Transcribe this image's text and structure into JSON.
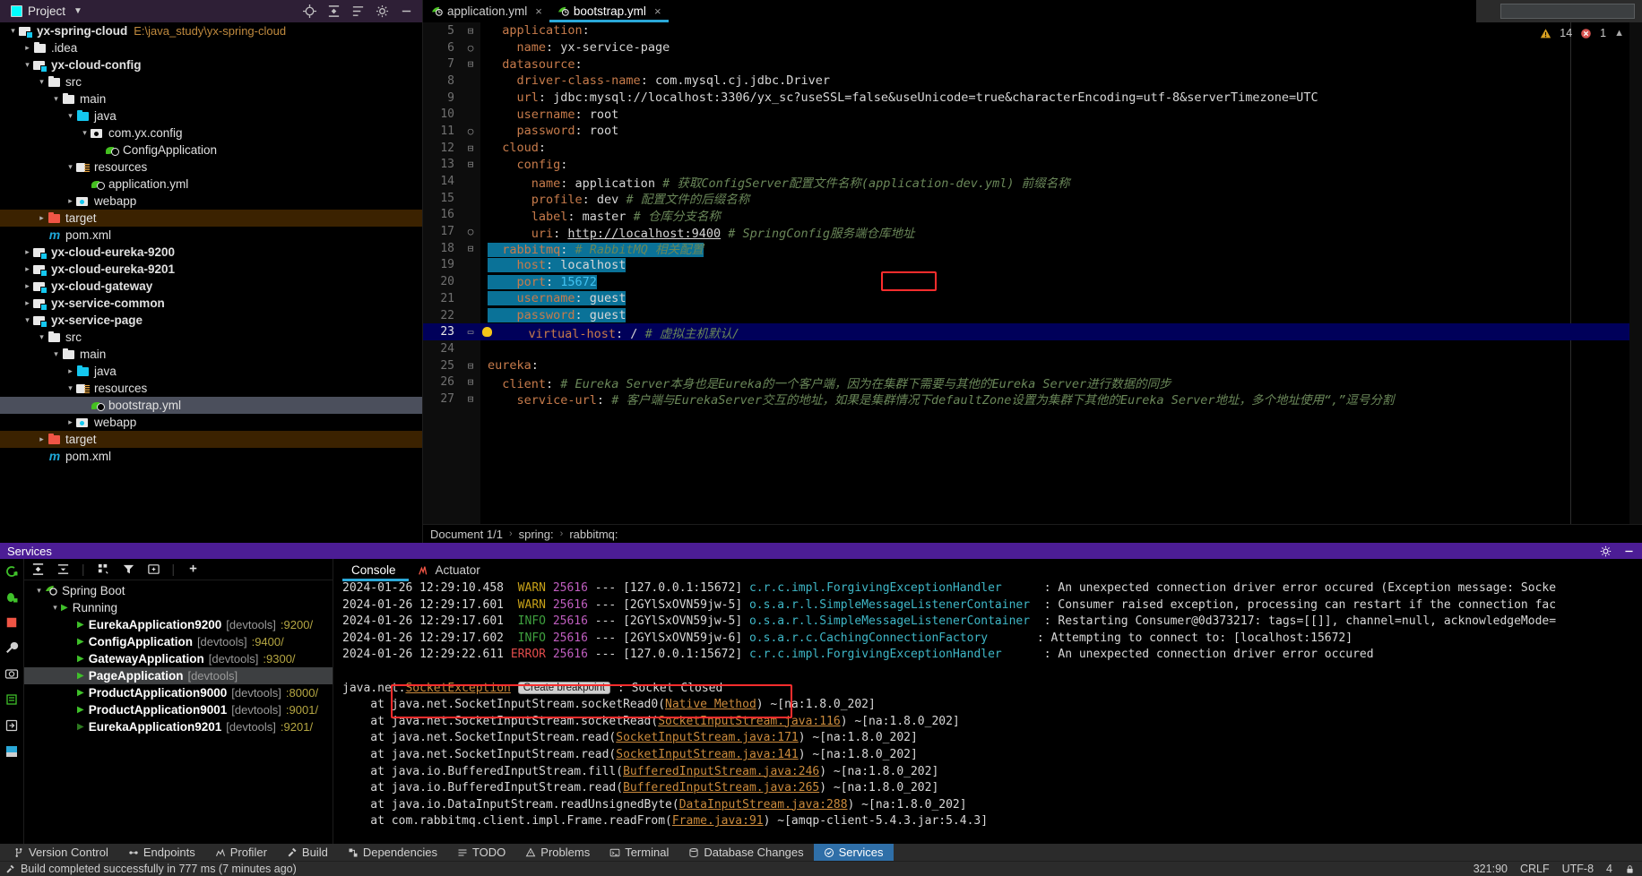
{
  "window": {
    "project_panel_title": "Project",
    "search_placeholder": ""
  },
  "editor_tabs": [
    {
      "label": "application.yml",
      "icon": "spring-yaml-icon",
      "active": false,
      "close": "×"
    },
    {
      "label": "bootstrap.yml",
      "icon": "spring-yaml-icon",
      "active": true,
      "close": "×"
    }
  ],
  "inspection_widget": {
    "warnings": "14",
    "errors": "1",
    "warn_icon": "warning-triangle-icon",
    "error_icon": "error-icon",
    "chevron": "⌃"
  },
  "project_tree": [
    {
      "indent": 0,
      "arrow": "v",
      "icon": "module-folder-icon",
      "label": "yx-spring-cloud",
      "bold": true,
      "path": "E:\\java_study\\yx-spring-cloud"
    },
    {
      "indent": 1,
      "arrow": ">",
      "icon": "folder-icon",
      "label": ".idea",
      "bold": false
    },
    {
      "indent": 1,
      "arrow": "v",
      "icon": "module-folder-icon",
      "label": "yx-cloud-config",
      "bold": true
    },
    {
      "indent": 2,
      "arrow": "v",
      "icon": "folder-icon",
      "label": "src",
      "bold": false
    },
    {
      "indent": 3,
      "arrow": "v",
      "icon": "folder-icon",
      "label": "main",
      "bold": false
    },
    {
      "indent": 4,
      "arrow": "v",
      "icon": "source-folder-icon",
      "label": "java",
      "bold": false
    },
    {
      "indent": 5,
      "arrow": "v",
      "icon": "package-icon",
      "label": "com.yx.config",
      "bold": false
    },
    {
      "indent": 6,
      "arrow": "",
      "icon": "spring-class-icon",
      "label": "ConfigApplication",
      "bold": false
    },
    {
      "indent": 4,
      "arrow": "v",
      "icon": "resources-folder-icon",
      "label": "resources",
      "bold": false
    },
    {
      "indent": 5,
      "arrow": "",
      "icon": "spring-yaml-icon",
      "label": "application.yml",
      "bold": false
    },
    {
      "indent": 4,
      "arrow": ">",
      "icon": "webapp-folder-icon",
      "label": "webapp",
      "bold": false
    },
    {
      "indent": 2,
      "arrow": ">",
      "icon": "target-folder-icon",
      "label": "target",
      "bold": false,
      "selected": "brown"
    },
    {
      "indent": 2,
      "arrow": "",
      "icon": "maven-icon",
      "label": "pom.xml",
      "bold": false
    },
    {
      "indent": 1,
      "arrow": ">",
      "icon": "module-folder-icon",
      "label": "yx-cloud-eureka-9200",
      "bold": true
    },
    {
      "indent": 1,
      "arrow": ">",
      "icon": "module-folder-icon",
      "label": "yx-cloud-eureka-9201",
      "bold": true
    },
    {
      "indent": 1,
      "arrow": ">",
      "icon": "module-folder-icon",
      "label": "yx-cloud-gateway",
      "bold": true
    },
    {
      "indent": 1,
      "arrow": ">",
      "icon": "module-folder-icon",
      "label": "yx-service-common",
      "bold": true
    },
    {
      "indent": 1,
      "arrow": "v",
      "icon": "module-folder-icon",
      "label": "yx-service-page",
      "bold": true
    },
    {
      "indent": 2,
      "arrow": "v",
      "icon": "folder-icon",
      "label": "src",
      "bold": false
    },
    {
      "indent": 3,
      "arrow": "v",
      "icon": "folder-icon",
      "label": "main",
      "bold": false
    },
    {
      "indent": 4,
      "arrow": ">",
      "icon": "source-folder-icon",
      "label": "java",
      "bold": false
    },
    {
      "indent": 4,
      "arrow": "v",
      "icon": "resources-folder-icon",
      "label": "resources",
      "bold": false
    },
    {
      "indent": 5,
      "arrow": "",
      "icon": "spring-yaml-icon",
      "label": "bootstrap.yml",
      "bold": false,
      "selected": "grey"
    },
    {
      "indent": 4,
      "arrow": ">",
      "icon": "webapp-folder-icon",
      "label": "webapp",
      "bold": false
    },
    {
      "indent": 2,
      "arrow": ">",
      "icon": "target-folder-icon",
      "label": "target",
      "bold": false,
      "selected": "brown"
    },
    {
      "indent": 2,
      "arrow": "",
      "icon": "maven-icon",
      "label": "pom.xml",
      "bold": false
    }
  ],
  "code_lines": [
    {
      "n": "5",
      "fold": "-",
      "html": "<span class='k'>  application</span><span class='v'>:</span>"
    },
    {
      "n": "6",
      "fold": "o",
      "html": "<span class='k'>    name</span><span class='v'>: yx-service-page</span>"
    },
    {
      "n": "7",
      "fold": "-",
      "html": "<span class='k'>  datasource</span><span class='v'>:</span>"
    },
    {
      "n": "8",
      "fold": "",
      "html": "<span class='k'>    driver-class-name</span><span class='v'>: com.mysql.cj.jdbc.Driver</span>"
    },
    {
      "n": "9",
      "fold": "",
      "html": "<span class='k'>    url</span><span class='v'>: jdbc:mysql://localhost:3306/yx_sc?useSSL=false&amp;useUnicode=true&amp;characterEncoding=utf-8&amp;serverTimezone=UTC</span>"
    },
    {
      "n": "10",
      "fold": "",
      "html": "<span class='k'>    username</span><span class='v'>: root</span>"
    },
    {
      "n": "11",
      "fold": "o",
      "html": "<span class='k'>    password</span><span class='v'>: root</span>"
    },
    {
      "n": "12",
      "fold": "-",
      "html": "<span class='k'>  cloud</span><span class='v'>:</span>"
    },
    {
      "n": "13",
      "fold": "-",
      "html": "<span class='k'>    config</span><span class='v'>:</span>"
    },
    {
      "n": "14",
      "fold": "",
      "html": "<span class='k'>      name</span><span class='v'>: application </span><span class='cm'># 获取ConfigServer配置文件名称(application-dev.yml) 前缀名称</span>"
    },
    {
      "n": "15",
      "fold": "",
      "html": "<span class='k'>      profile</span><span class='v'>: dev </span><span class='cm'># 配置文件的后缀名称</span>"
    },
    {
      "n": "16",
      "fold": "",
      "html": "<span class='k'>      label</span><span class='v'>: master </span><span class='cm'># 仓库分支名称</span>"
    },
    {
      "n": "17",
      "fold": "o",
      "html": "<span class='k'>      uri</span><span class='v'>: </span><span class='lnk'>http://localhost:9400</span><span class='v'> </span><span class='cm'># SpringConfig服务端仓库地址</span>"
    },
    {
      "n": "18",
      "fold": "-",
      "hl": "span",
      "html": "<span class='k'>  rabbitmq</span><span class='v'>: </span><span class='cm'># RabbitMQ 相关配置</span>"
    },
    {
      "n": "19",
      "fold": "",
      "hl": "span",
      "html": "<span class='k'>    host</span><span class='v'>: localhost</span>"
    },
    {
      "n": "20",
      "fold": "",
      "hl": "span",
      "html": "<span class='k'>    port</span><span class='v'>: </span><span class='num'>15672</span>"
    },
    {
      "n": "21",
      "fold": "",
      "hl": "span",
      "html": "<span class='k'>    username</span><span class='v'>: guest</span>"
    },
    {
      "n": "22",
      "fold": "",
      "hl": "span",
      "html": "<span class='k'>    password</span><span class='v'>: guest</span>"
    },
    {
      "n": "23",
      "fold": "o",
      "bulb": true,
      "hl": "cur",
      "html": "<span class='k'>    virtual-host</span><span class='v'>: / </span><span class='cm'># 虚拟主机默认/</span>"
    },
    {
      "n": "24",
      "fold": "",
      "html": ""
    },
    {
      "n": "25",
      "fold": "-",
      "html": "<span class='k'>eureka</span><span class='v'>:</span>"
    },
    {
      "n": "26",
      "fold": "-",
      "html": "<span class='k'>  client</span><span class='v'>: </span><span class='cm'># Eureka Server本身也是Eureka的一个客户端，因为在集群下需要与其他的Eureka Server进行数据的同步</span>"
    },
    {
      "n": "27",
      "fold": "-",
      "html": "<span class='k'>    service-url</span><span class='v'>: </span><span class='cm'># 客户端与EurekaServer交互的地址，如果是集群情况下defaultZone设置为集群下其他的Eureka Server地址，多个地址使用“,”逗号分割</span>"
    }
  ],
  "breadcrumb": {
    "document": "Document 1/1",
    "sep": "›",
    "crumbs": [
      "spring:",
      "rabbitmq:"
    ]
  },
  "services_panel": {
    "title": "Services",
    "settings_icon": "gear-icon",
    "hide_icon": "minimize-icon"
  },
  "services_tree": [
    {
      "indent": 0,
      "arrow": "v",
      "icon": "spring-boot-icon",
      "label": "Spring Boot"
    },
    {
      "indent": 1,
      "arrow": "v",
      "icon": "run-icon",
      "label": "Running"
    },
    {
      "indent": 2,
      "arrow": "",
      "icon": "run-icon",
      "label": "EurekaApplication9200",
      "devtools": "[devtools]",
      "port": ":9200/"
    },
    {
      "indent": 2,
      "arrow": "",
      "icon": "run-icon",
      "label": "ConfigApplication",
      "devtools": "[devtools]",
      "port": ":9400/"
    },
    {
      "indent": 2,
      "arrow": "",
      "icon": "run-icon",
      "label": "GatewayApplication",
      "devtools": "[devtools]",
      "port": ":9300/"
    },
    {
      "indent": 2,
      "arrow": "",
      "icon": "run-icon",
      "label": "PageApplication",
      "devtools": "[devtools]",
      "port": "",
      "selected": true
    },
    {
      "indent": 2,
      "arrow": "",
      "icon": "run-icon",
      "label": "ProductApplication9000",
      "devtools": "[devtools]",
      "port": ":8000/"
    },
    {
      "indent": 2,
      "arrow": "",
      "icon": "run-icon",
      "label": "ProductApplication9001",
      "devtools": "[devtools]",
      "port": ":9001/"
    },
    {
      "indent": 2,
      "arrow": "",
      "icon": "run-icon-dim",
      "label": "EurekaApplication9201",
      "devtools": "[devtools]",
      "port": ":9201/"
    }
  ],
  "console_tabs": [
    {
      "label": "Console",
      "active": true
    },
    {
      "label": "Actuator",
      "active": false,
      "icon": "actuator-icon"
    }
  ],
  "console_lines": [
    {
      "html": "<span class='ts'>2024-01-26 12:29:10.458</span>  <span class='w-warn'>WARN</span> <span class='pid'>25616</span> <span class='msg'>---</span> <span class='thr'>[127.0.0.1:15672]</span> <span class='cls'>c.r.c.impl.ForgivingExceptionHandler</span>      <span class='msg'>: An unexpected connection driver error occured (Exception message: Socke</span>"
    },
    {
      "html": "<span class='ts'>2024-01-26 12:29:17.601</span>  <span class='w-warn'>WARN</span> <span class='pid'>25616</span> <span class='msg'>---</span> <span class='thr'>[2GYlSxOVN59jw-5]</span> <span class='cls'>o.s.a.r.l.SimpleMessageListenerContainer</span>  <span class='msg'>: Consumer raised exception, processing can restart if the connection fac</span>"
    },
    {
      "html": "<span class='ts'>2024-01-26 12:29:17.601</span>  <span class='w-info'>INFO</span> <span class='pid'>25616</span> <span class='msg'>---</span> <span class='thr'>[2GYlSxOVN59jw-5]</span> <span class='cls'>o.s.a.r.l.SimpleMessageListenerContainer</span>  <span class='msg'>: Restarting Consumer@0d373217: tags=[[]], channel=null, acknowledgeMode=</span>"
    },
    {
      "html": "<span class='ts'>2024-01-26 12:29:17.602</span>  <span class='w-info'>INFO</span> <span class='pid'>25616</span> <span class='msg'>---</span> <span class='thr'>[2GYlSxOVN59jw-6]</span> <span class='cls'>o.s.a.r.c.CachingConnectionFactory</span>       <span class='msg'>: Attempting to connect to: [localhost:15672]</span>"
    },
    {
      "html": "<span class='ts'>2024-01-26 12:29:22.611</span> <span class='w-err'>ERROR</span> <span class='pid'>25616</span> <span class='msg'>---</span> <span class='thr'>[127.0.0.1:15672]</span> <span class='cls'>c.r.c.impl.ForgivingExceptionHandler</span>      <span class='msg'>: An unexpected connection driver error occured</span>"
    },
    {
      "html": ""
    },
    {
      "html": "<span class='msg'>java.net.</span><span class='ex-lnk'>SocketException</span> <span class='bp-chip'>Create breakpoint</span><span class='msg'> : Socket Closed</span>"
    },
    {
      "html": "<span class='msg'>    at java.net.SocketInputStream.socketRead0(</span><span class='ex-lnk'>Native Method</span><span class='msg'>) ~[na:1.8.0_202]</span>"
    },
    {
      "html": "<span class='msg'>    at java.net.SocketInputStream.socketRead(</span><span class='ex-lnk'>SocketInputStream.java:116</span><span class='msg'>) ~[na:1.8.0_202]</span>"
    },
    {
      "html": "<span class='msg'>    at java.net.SocketInputStream.read(</span><span class='ex-lnk'>SocketInputStream.java:171</span><span class='msg'>) ~[na:1.8.0_202]</span>"
    },
    {
      "html": "<span class='msg'>    at java.net.SocketInputStream.read(</span><span class='ex-lnk'>SocketInputStream.java:141</span><span class='msg'>) ~[na:1.8.0_202]</span>"
    },
    {
      "html": "<span class='msg'>    at java.io.BufferedInputStream.fill(</span><span class='ex-lnk'>BufferedInputStream.java:246</span><span class='msg'>) ~[na:1.8.0_202]</span>"
    },
    {
      "html": "<span class='msg'>    at java.io.BufferedInputStream.read(</span><span class='ex-lnk'>BufferedInputStream.java:265</span><span class='msg'>) ~[na:1.8.0_202]</span>"
    },
    {
      "html": "<span class='msg'>    at java.io.DataInputStream.readUnsignedByte(</span><span class='ex-lnk'>DataInputStream.java:288</span><span class='msg'>) ~[na:1.8.0_202]</span>"
    },
    {
      "html": "<span class='msg'>    at com.rabbitmq.client.impl.Frame.readFrom(</span><span class='ex-lnk'>Frame.java:91</span><span class='msg'>) ~[amqp-client-5.4.3.jar:5.4.3]</span>"
    }
  ],
  "status_bar_items": [
    {
      "label": "Version Control",
      "icon": "branch-icon",
      "active": false
    },
    {
      "label": "Endpoints",
      "icon": "endpoints-icon",
      "active": false
    },
    {
      "label": "Profiler",
      "icon": "profiler-icon",
      "active": false
    },
    {
      "label": "Build",
      "icon": "hammer-icon",
      "active": false
    },
    {
      "label": "Dependencies",
      "icon": "dependencies-icon",
      "active": false
    },
    {
      "label": "TODO",
      "icon": "todo-icon",
      "active": false
    },
    {
      "label": "Problems",
      "icon": "problems-icon",
      "active": false
    },
    {
      "label": "Terminal",
      "icon": "terminal-icon",
      "active": false
    },
    {
      "label": "Database Changes",
      "icon": "database-icon",
      "active": false
    },
    {
      "label": "Services",
      "icon": "services-icon",
      "active": true
    }
  ],
  "build_status": {
    "text": "Build completed successfully in 777 ms (7 minutes ago)",
    "icon": "hammer-icon"
  },
  "caret_status": {
    "position": "321:90",
    "line_sep": "CRLF",
    "encoding": "UTF-8",
    "indent": "4",
    "lock_icon": "lock-icon"
  },
  "colors": {
    "accent_blue": "#2aa8d8",
    "selection_teal": "#0a7298",
    "caret_line": "#00005a",
    "services_purple": "#4c1d95",
    "status_active": "#2f6fa8",
    "highlight_red": "#ff2d2d",
    "keyword_orange": "#c77b4b",
    "comment_green": "#6a8759",
    "number_cyan": "#41c1f0"
  }
}
